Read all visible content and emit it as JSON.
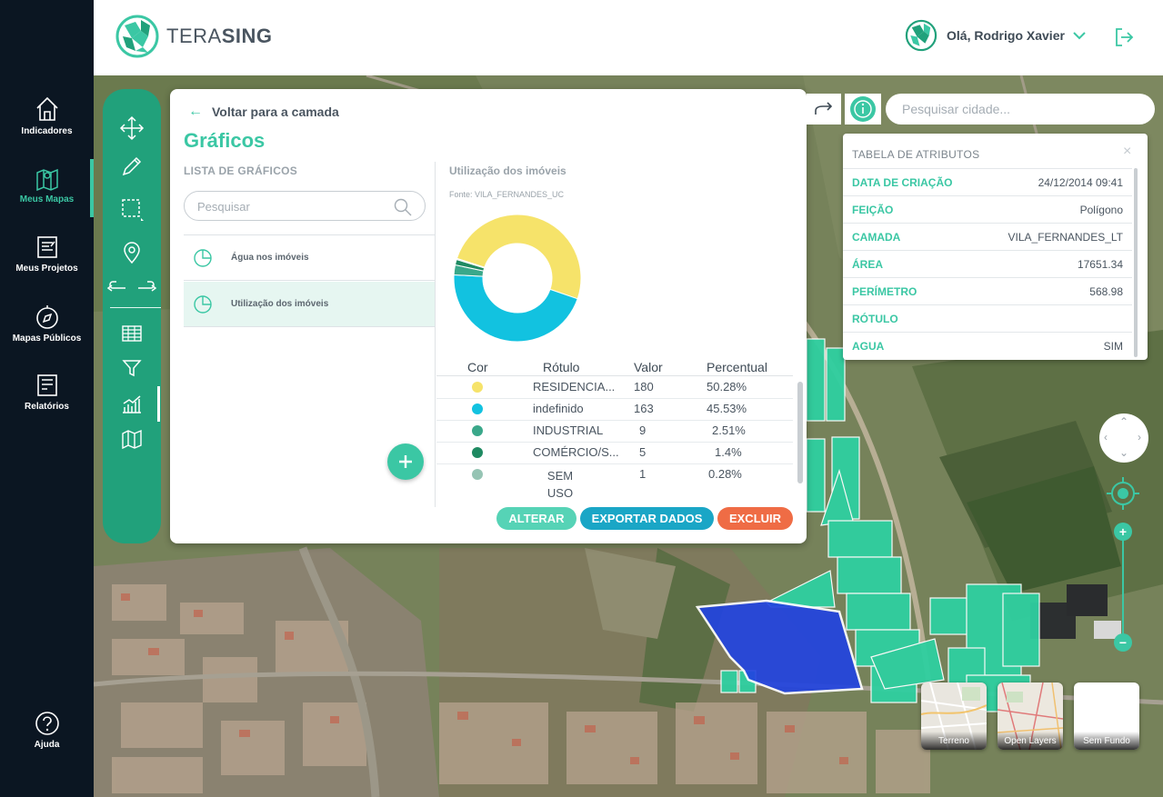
{
  "brand": {
    "name_light": "TERA",
    "name_bold": "SING"
  },
  "user": {
    "greeting": "Olá, Rodrigo Xavier"
  },
  "nav": {
    "items": [
      {
        "label": "Indicadores"
      },
      {
        "label": "Meus Mapas"
      },
      {
        "label": "Meus Projetos"
      },
      {
        "label": "Mapas Públicos"
      },
      {
        "label": "Relatórios"
      }
    ],
    "help": "Ajuda",
    "active_index": 1
  },
  "charts_panel": {
    "back_label": "Voltar para a camada",
    "title": "Gráficos",
    "list_title": "LISTA DE GRÁFICOS",
    "search_placeholder": "Pesquisar",
    "items": [
      {
        "label": "Água nos imóveis"
      },
      {
        "label": "Utilização dos imóveis"
      }
    ],
    "selected_index": 1,
    "chart_title": "Utilização dos imóveis",
    "chart_source": "Fonte: VILA_FERNANDES_UC",
    "legend_headers": {
      "cor": "Cor",
      "rotulo": "Rótulo",
      "valor": "Valor",
      "percentual": "Percentual"
    },
    "buttons": {
      "alterar": "ALTERAR",
      "exportar": "EXPORTAR DADOS",
      "excluir": "EXCLUIR"
    }
  },
  "chart_data": {
    "type": "pie",
    "title": "Utilização dos imóveis",
    "subtitle": "Fonte: VILA_FERNANDES_UC",
    "donut": true,
    "slices": [
      {
        "label": "RESIDENCIA...",
        "value": 180,
        "percent": "50.28%",
        "color": "#f6e36a"
      },
      {
        "label": "indefinido",
        "value": 163,
        "percent": "45.53%",
        "color": "#12c2e0"
      },
      {
        "label": "INDUSTRIAL",
        "value": 9,
        "percent": "2.51%",
        "color": "#3aa88a"
      },
      {
        "label": "COMÉRCIO/S...",
        "value": 5,
        "percent": "1.4%",
        "color": "#1f8a62"
      },
      {
        "label": "SEM USO",
        "value": 1,
        "percent": "0.28%",
        "color": "#96c4b4"
      }
    ]
  },
  "map_controls": {
    "city_search_placeholder": "Pesquisar cidade..."
  },
  "attributes": {
    "title": "TABELA DE ATRIBUTOS",
    "rows": [
      {
        "key": "DATA DE CRIAÇÃO",
        "value": "24/12/2014 09:41"
      },
      {
        "key": "FEIÇÃO",
        "value": "Polígono"
      },
      {
        "key": "CAMADA",
        "value": "VILA_FERNANDES_LT"
      },
      {
        "key": "ÁREA",
        "value": "17651.34"
      },
      {
        "key": "PERÍMETRO",
        "value": "568.98"
      },
      {
        "key": "RÓTULO",
        "value": ""
      },
      {
        "key": "AGUA",
        "value": "SIM"
      }
    ]
  },
  "basemaps": [
    {
      "label": "Terreno"
    },
    {
      "label": "Open Layers"
    },
    {
      "label": "Sem Fundo"
    }
  ],
  "colors": {
    "accent": "#3bc7a4",
    "nav_bg": "#0b1622",
    "toolbar": "#21a17b",
    "parcels": "#2fcfa0",
    "selected_parcel": "#2244e0"
  }
}
